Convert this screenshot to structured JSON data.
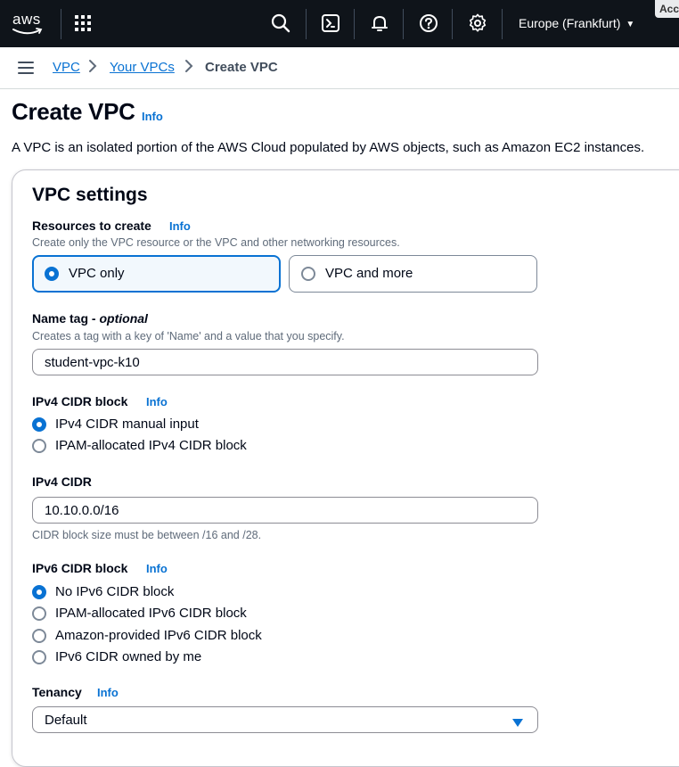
{
  "topnav": {
    "logo_text": "aws",
    "region": "Europe (Frankfurt)",
    "account_tab": "Acc",
    "icons": [
      "grid-icon",
      "search-icon",
      "cloudshell-icon",
      "bell-icon",
      "help-icon",
      "gear-icon"
    ]
  },
  "breadcrumb": {
    "items": [
      "VPC",
      "Your VPCs",
      "Create VPC"
    ]
  },
  "page": {
    "title": "Create VPC",
    "title_info": "Info",
    "description": "A VPC is an isolated portion of the AWS Cloud populated by AWS objects, such as Amazon EC2 instances."
  },
  "settings": {
    "title": "VPC settings",
    "resources": {
      "label": "Resources to create",
      "info": "Info",
      "description": "Create only the VPC resource or the VPC and other networking resources.",
      "options": [
        "VPC only",
        "VPC and more"
      ],
      "selected": "VPC only"
    },
    "name_tag": {
      "label": "Name tag",
      "label_optional": "optional",
      "description": "Creates a tag with a key of 'Name' and a value that you specify.",
      "value": "student-vpc-k10"
    },
    "ipv4_block": {
      "label": "IPv4 CIDR block",
      "info": "Info",
      "options": [
        "IPv4 CIDR manual input",
        "IPAM-allocated IPv4 CIDR block"
      ],
      "selected": "IPv4 CIDR manual input"
    },
    "ipv4_cidr": {
      "label": "IPv4 CIDR",
      "value": "10.10.0.0/16",
      "constraint": "CIDR block size must be between /16 and /28."
    },
    "ipv6_block": {
      "label": "IPv6 CIDR block",
      "info": "Info",
      "options": [
        "No IPv6 CIDR block",
        "IPAM-allocated IPv6 CIDR block",
        "Amazon-provided IPv6 CIDR block",
        "IPv6 CIDR owned by me"
      ],
      "selected": "No IPv6 CIDR block"
    },
    "tenancy": {
      "label": "Tenancy",
      "info": "Info",
      "value": "Default"
    }
  },
  "colors": {
    "nav_bg": "#0f141a",
    "link": "#0972d3",
    "selected_tile_bg": "#f2f8fd",
    "text": "#000716",
    "muted": "#5f6b7a"
  }
}
